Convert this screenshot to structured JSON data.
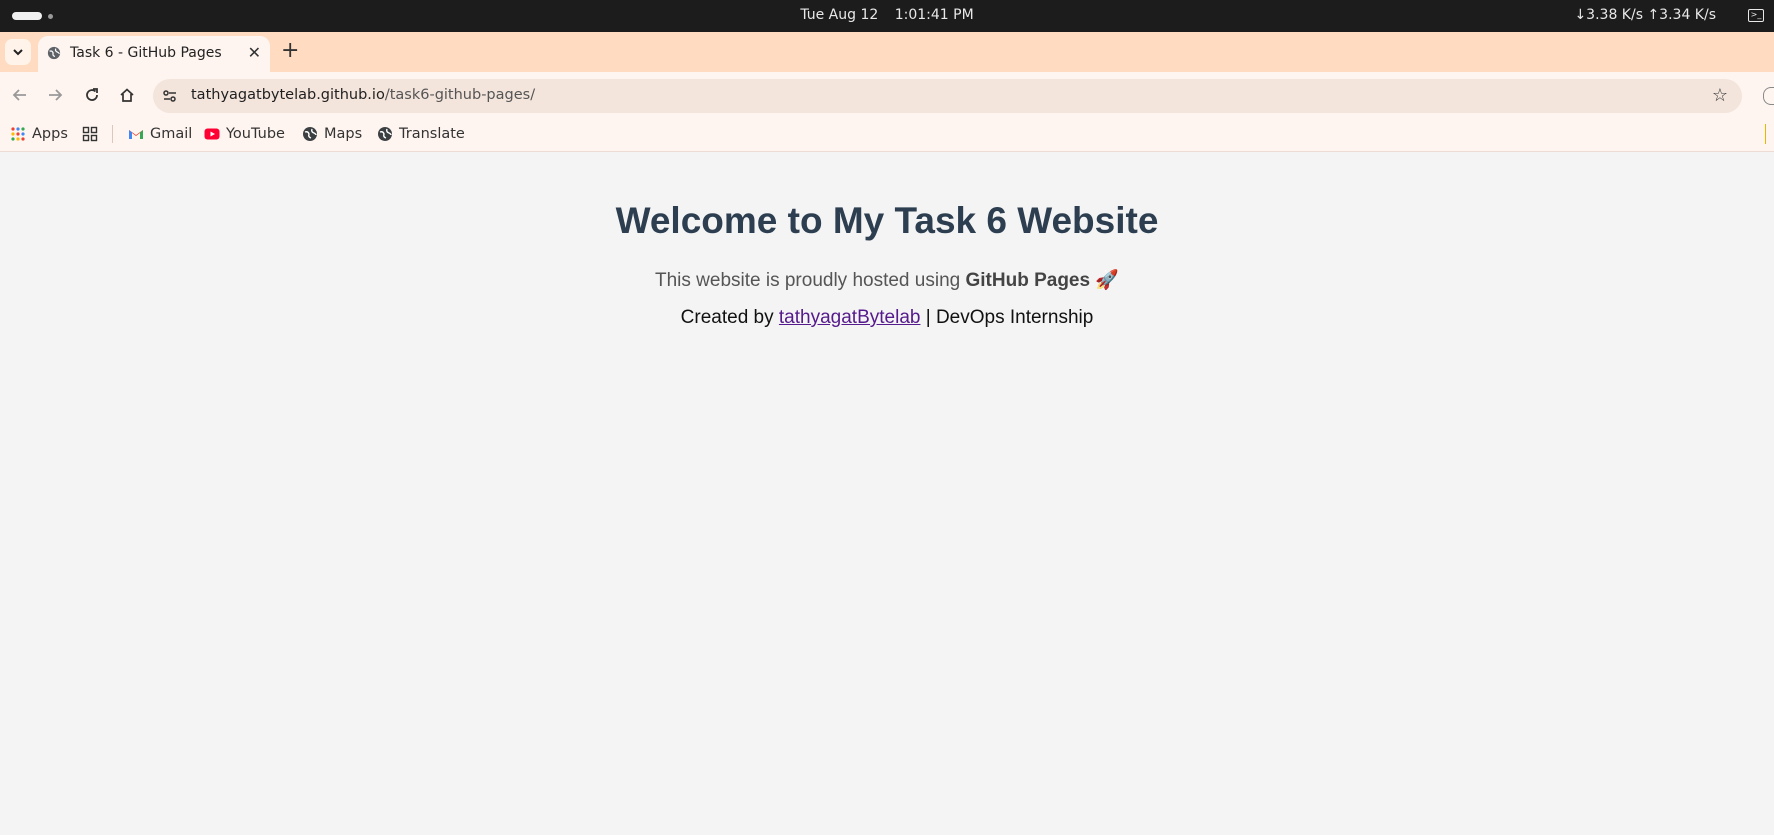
{
  "system_bar": {
    "date": "Tue Aug 12",
    "time": "1:01:41 PM",
    "network": "↓3.38 K/s ↑3.34 K/s"
  },
  "tabs": [
    {
      "title": "Task 6 - GitHub Pages",
      "close_glyph": "✕"
    }
  ],
  "new_tab_glyph": "+",
  "omnibox": {
    "host": "tathyagatbytelab.github.io",
    "path": "/task6-github-pages/"
  },
  "bookmarks": {
    "apps": "Apps",
    "items": [
      {
        "label": "Gmail",
        "icon": "gmail-icon"
      },
      {
        "label": "YouTube",
        "icon": "youtube-icon"
      },
      {
        "label": "Maps",
        "icon": "globe-icon"
      },
      {
        "label": "Translate",
        "icon": "globe-icon"
      }
    ]
  },
  "page": {
    "heading": "Welcome to My Task 6 Website",
    "lead_prefix": "This website is proudly hosted using ",
    "lead_bold": "GitHub Pages",
    "lead_emoji": "🚀",
    "credit_prefix": "Created by ",
    "credit_link": "tathyagatBytelab",
    "credit_suffix": " | DevOps Internship"
  },
  "colors": {
    "tab_strip": "#fedbc1",
    "toolbar": "#fff5f0",
    "heading": "#2c3e50",
    "link_visited": "#551a8b",
    "page_bg": "#f4f4f4"
  }
}
